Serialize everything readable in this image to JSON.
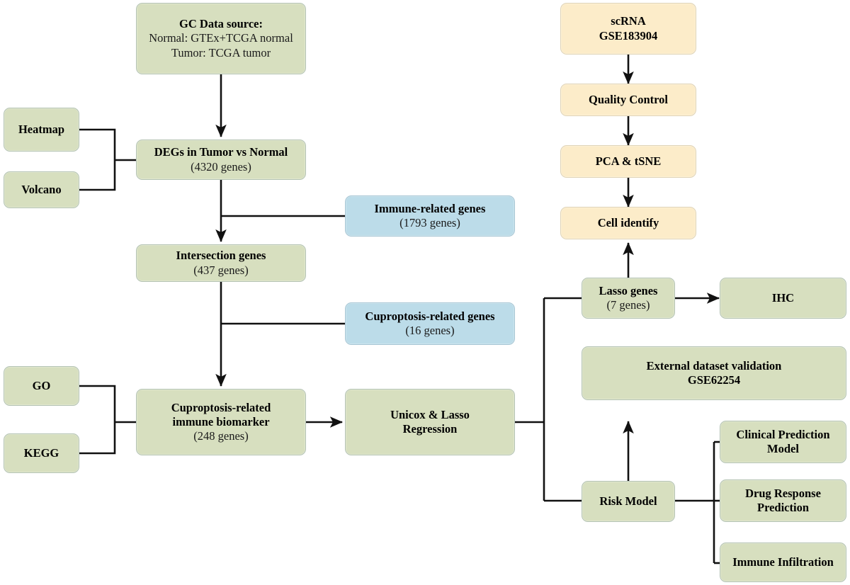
{
  "diagram": {
    "title": "Study workflow flowchart",
    "colors": {
      "green": "#d7dfbf",
      "blue": "#bcdce9",
      "cream": "#fcecc9",
      "border": "#b9c6c0",
      "line": "#111111",
      "text": "#000000"
    }
  },
  "nodes": {
    "gc_data_source": {
      "line1": "GC Data source:",
      "line2": "Normal: GTEx+TCGA normal",
      "line3": "Tumor: TCGA tumor"
    },
    "heatmap": {
      "line1": "Heatmap"
    },
    "volcano": {
      "line1": "Volcano"
    },
    "degs": {
      "line1": "DEGs in Tumor vs Normal",
      "line2": "(4320 genes)"
    },
    "immune_related_genes": {
      "line1": "Immune-related genes",
      "line2": "(1793 genes)"
    },
    "intersection_genes": {
      "line1": "Intersection genes",
      "line2": "(437 genes)"
    },
    "cuproptosis_related_genes": {
      "line1": "Cuproptosis-related genes",
      "line2": "(16 genes)"
    },
    "go": {
      "line1": "GO"
    },
    "kegg": {
      "line1": "KEGG"
    },
    "cuproptosis_immune_biomarker": {
      "line1": "Cuproptosis-related",
      "line2": "immune biomarker",
      "line3": "(248 genes)"
    },
    "unicox_lasso_regression": {
      "line1": "Unicox & Lasso",
      "line2": "Regression"
    },
    "scrna": {
      "line1": "scRNA",
      "line2": "GSE183904"
    },
    "quality_control": {
      "line1": "Quality Control"
    },
    "pca_tsne": {
      "line1": "PCA & tSNE"
    },
    "cell_identify": {
      "line1": "Cell identify"
    },
    "lasso_genes": {
      "line1": "Lasso genes",
      "line2": "(7 genes)"
    },
    "ihc": {
      "line1": "IHC"
    },
    "external_validation": {
      "line1": "External dataset validation",
      "line2": "GSE62254"
    },
    "risk_model": {
      "line1": "Risk Model"
    },
    "clinical_prediction_model": {
      "line1": "Clinical Prediction",
      "line2": "Model"
    },
    "drug_response_prediction": {
      "line1": "Drug Response",
      "line2": "Prediction"
    },
    "immune_infiltration": {
      "line1": "Immune Infiltration"
    }
  }
}
